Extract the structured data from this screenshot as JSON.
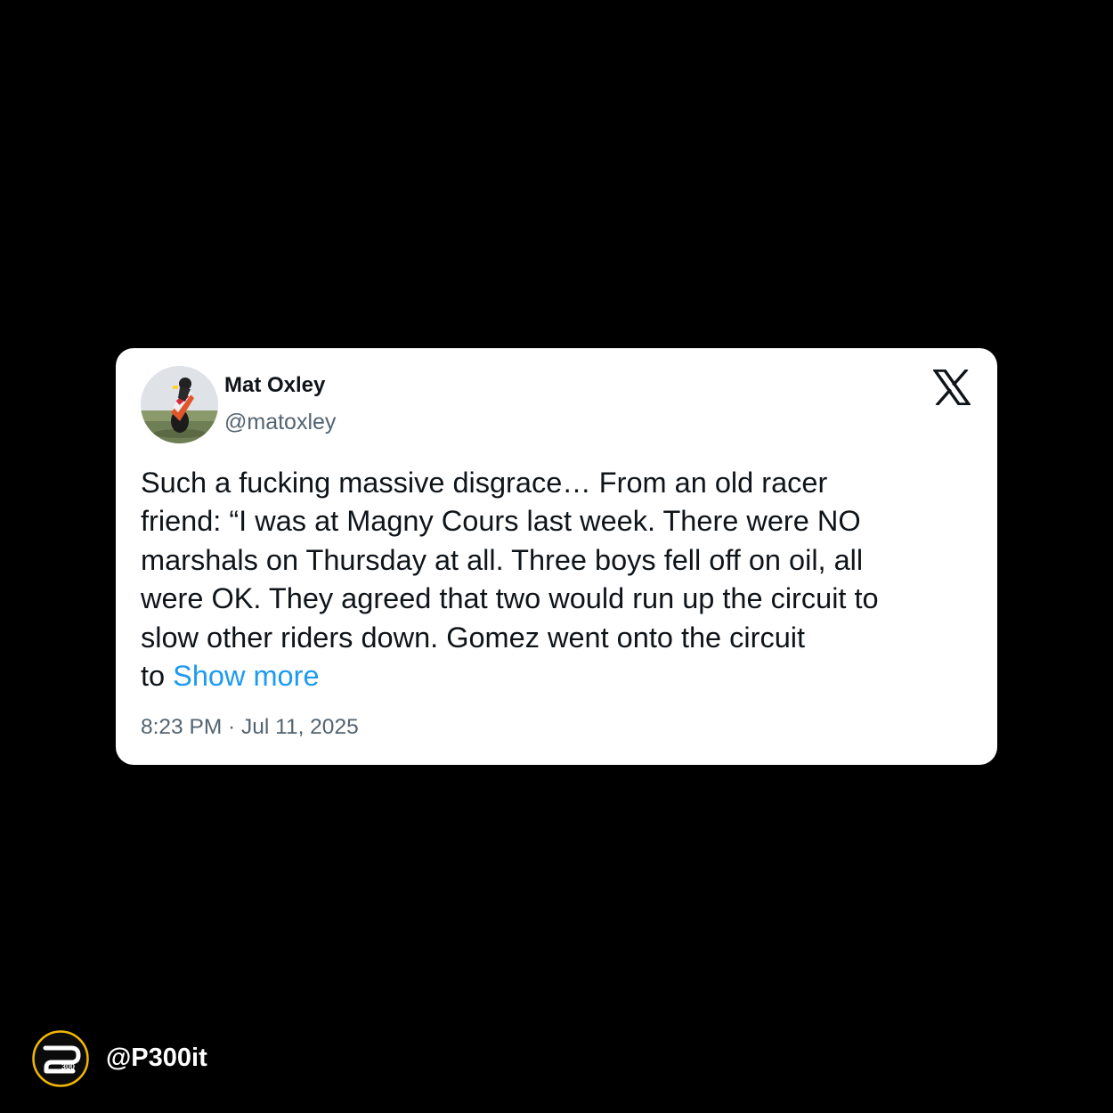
{
  "tweet": {
    "display_name": "Mat Oxley",
    "handle": "@matoxley",
    "text_lines": [
      "Such a fucking massive disgrace… From an old racer",
      "friend: “I was at Magny Cours last week. There were NO",
      "marshals on Thursday at all. Three boys fell off on oil, all",
      "were OK. They agreed that two would run up the circuit to",
      "slow other riders down. Gomez went onto the circuit"
    ],
    "last_line_prefix": "to ",
    "show_more_label": "Show more",
    "timestamp": "8:23 PM · Jul 11, 2025",
    "platform_icon": "x-logo-icon"
  },
  "watermark": {
    "handle": "@P300it",
    "logo_text": "300"
  },
  "colors": {
    "background": "#000000",
    "card": "#ffffff",
    "text_primary": "#0f1419",
    "text_secondary": "#536471",
    "link": "#1d9bf0",
    "watermark_ring": "#f2b705"
  }
}
